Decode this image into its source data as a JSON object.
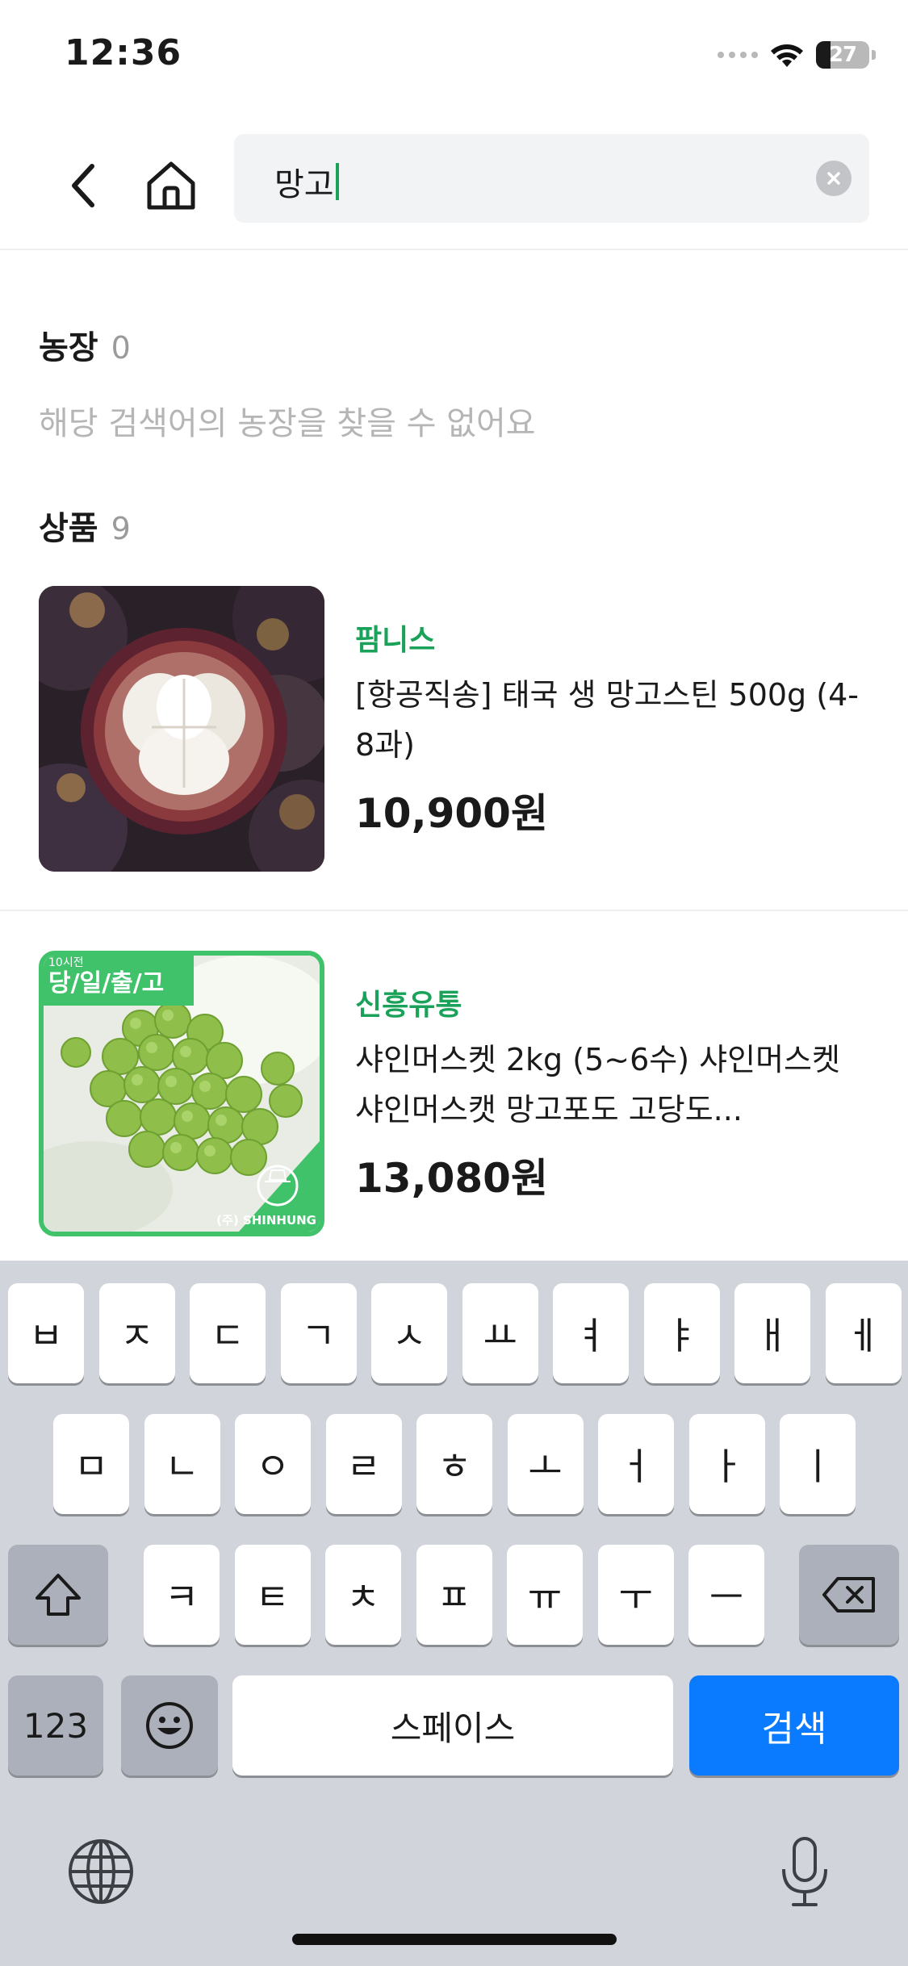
{
  "status_bar": {
    "time": "12:36",
    "battery_percent": "27",
    "battery_level": 0.27
  },
  "search": {
    "query": "망고"
  },
  "farm_section": {
    "title": "농장",
    "count": "0",
    "empty_message": "해당 검색어의 농장을 찾을 수 없어요"
  },
  "product_section": {
    "title": "상품",
    "count": "9"
  },
  "products": [
    {
      "seller": "팜니스",
      "name": "[항공직송] 태국 생 망고스틴 500g (4-8과)",
      "price": "10,900원"
    },
    {
      "seller": "신흥유통",
      "name": "샤인머스켓 2kg (5~6수) 샤인머스켓 샤인머스캣 망고포도 고당도...",
      "price": "13,080원",
      "image_badge_small": "10시전",
      "image_badge": "당/일/출/고",
      "image_brand": "(주) SHINHUNG"
    }
  ],
  "keyboard": {
    "row1": [
      "ㅂ",
      "ㅈ",
      "ㄷ",
      "ㄱ",
      "ㅅ",
      "ㅛ",
      "ㅕ",
      "ㅑ",
      "ㅐ",
      "ㅔ"
    ],
    "row2": [
      "ㅁ",
      "ㄴ",
      "ㅇ",
      "ㄹ",
      "ㅎ",
      "ㅗ",
      "ㅓ",
      "ㅏ",
      "ㅣ"
    ],
    "row3": [
      "ㅋ",
      "ㅌ",
      "ㅊ",
      "ㅍ",
      "ㅠ",
      "ㅜ",
      "ㅡ"
    ],
    "numbers_label": "123",
    "space_label": "스페이스",
    "search_label": "검색"
  },
  "colors": {
    "accent_green": "#1ba25a",
    "key_blue": "#0a7aff",
    "keyboard_bg": "#d1d4da"
  }
}
